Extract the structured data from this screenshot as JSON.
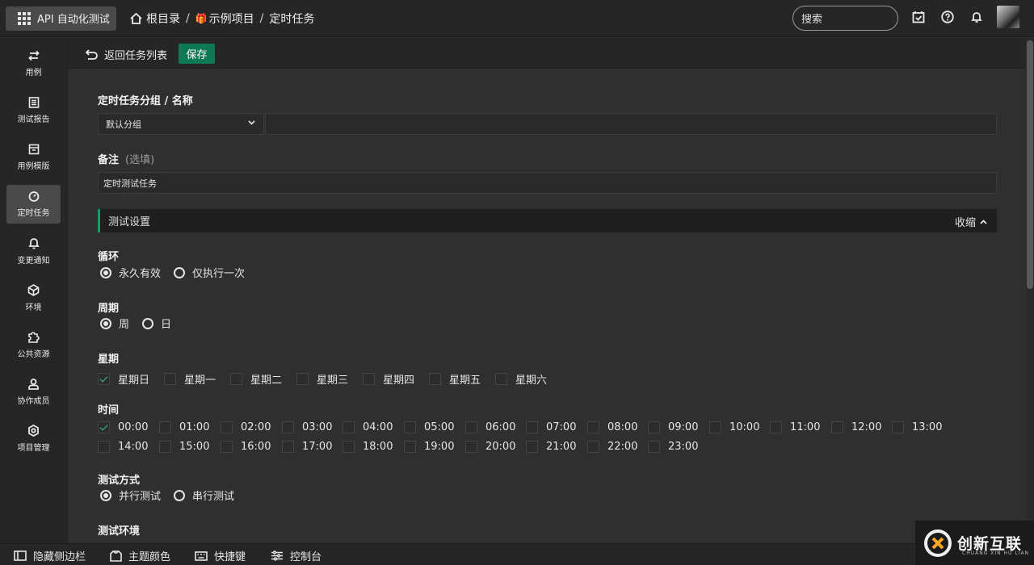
{
  "app": {
    "title": "API 自动化测试"
  },
  "breadcrumb": {
    "root": "根目录",
    "project": "示例项目",
    "current": "定时任务"
  },
  "search": {
    "placeholder": "搜索"
  },
  "sidebar": {
    "items": [
      {
        "label": "用例",
        "icon": "cases-icon"
      },
      {
        "label": "测试报告",
        "icon": "report-icon"
      },
      {
        "label": "用例模版",
        "icon": "template-icon"
      },
      {
        "label": "定时任务",
        "icon": "timer-icon",
        "active": true
      },
      {
        "label": "变更通知",
        "icon": "bell-icon"
      },
      {
        "label": "环境",
        "icon": "environment-icon"
      },
      {
        "label": "公共资源",
        "icon": "puzzle-icon"
      },
      {
        "label": "协作成员",
        "icon": "member-icon"
      },
      {
        "label": "项目管理",
        "icon": "settings-icon"
      }
    ]
  },
  "actions": {
    "back": "返回任务列表",
    "save": "保存"
  },
  "form": {
    "group_name_label": "定时任务分组 / 名称",
    "group_value": "默认分组",
    "name_value": "",
    "remark_label": "备注",
    "remark_hint": "(选填)",
    "remark_value": "定时测试任务",
    "section_title": "测试设置",
    "collapse_label": "收缩",
    "loop_label": "循环",
    "loop_options": [
      "永久有效",
      "仅执行一次"
    ],
    "loop_selected": "永久有效",
    "period_label": "周期",
    "period_options": [
      "周",
      "日"
    ],
    "period_selected": "周",
    "weekday_label": "星期",
    "weekdays": [
      "星期日",
      "星期一",
      "星期二",
      "星期三",
      "星期四",
      "星期五",
      "星期六"
    ],
    "weekdays_checked": [
      "星期日"
    ],
    "time_label": "时间",
    "times": [
      "00:00",
      "01:00",
      "02:00",
      "03:00",
      "04:00",
      "05:00",
      "06:00",
      "07:00",
      "08:00",
      "09:00",
      "10:00",
      "11:00",
      "12:00",
      "13:00",
      "14:00",
      "15:00",
      "16:00",
      "17:00",
      "18:00",
      "19:00",
      "20:00",
      "21:00",
      "22:00",
      "23:00"
    ],
    "times_checked": [
      "00:00"
    ],
    "mode_label": "测试方式",
    "mode_options": [
      "并行测试",
      "串行测试"
    ],
    "mode_selected": "并行测试",
    "env_label": "测试环境"
  },
  "bottombar": {
    "hide_sidebar": "隐藏侧边栏",
    "theme": "主题颜色",
    "shortcuts": "快捷键",
    "console": "控制台"
  },
  "watermark": {
    "name": "创新互联",
    "sub": "CHUANG XIN HU LIAN"
  },
  "colors": {
    "accent": "#0e7a55",
    "section_border": "#10a06a",
    "background": "#2f2f2f",
    "panel": "#262626"
  }
}
